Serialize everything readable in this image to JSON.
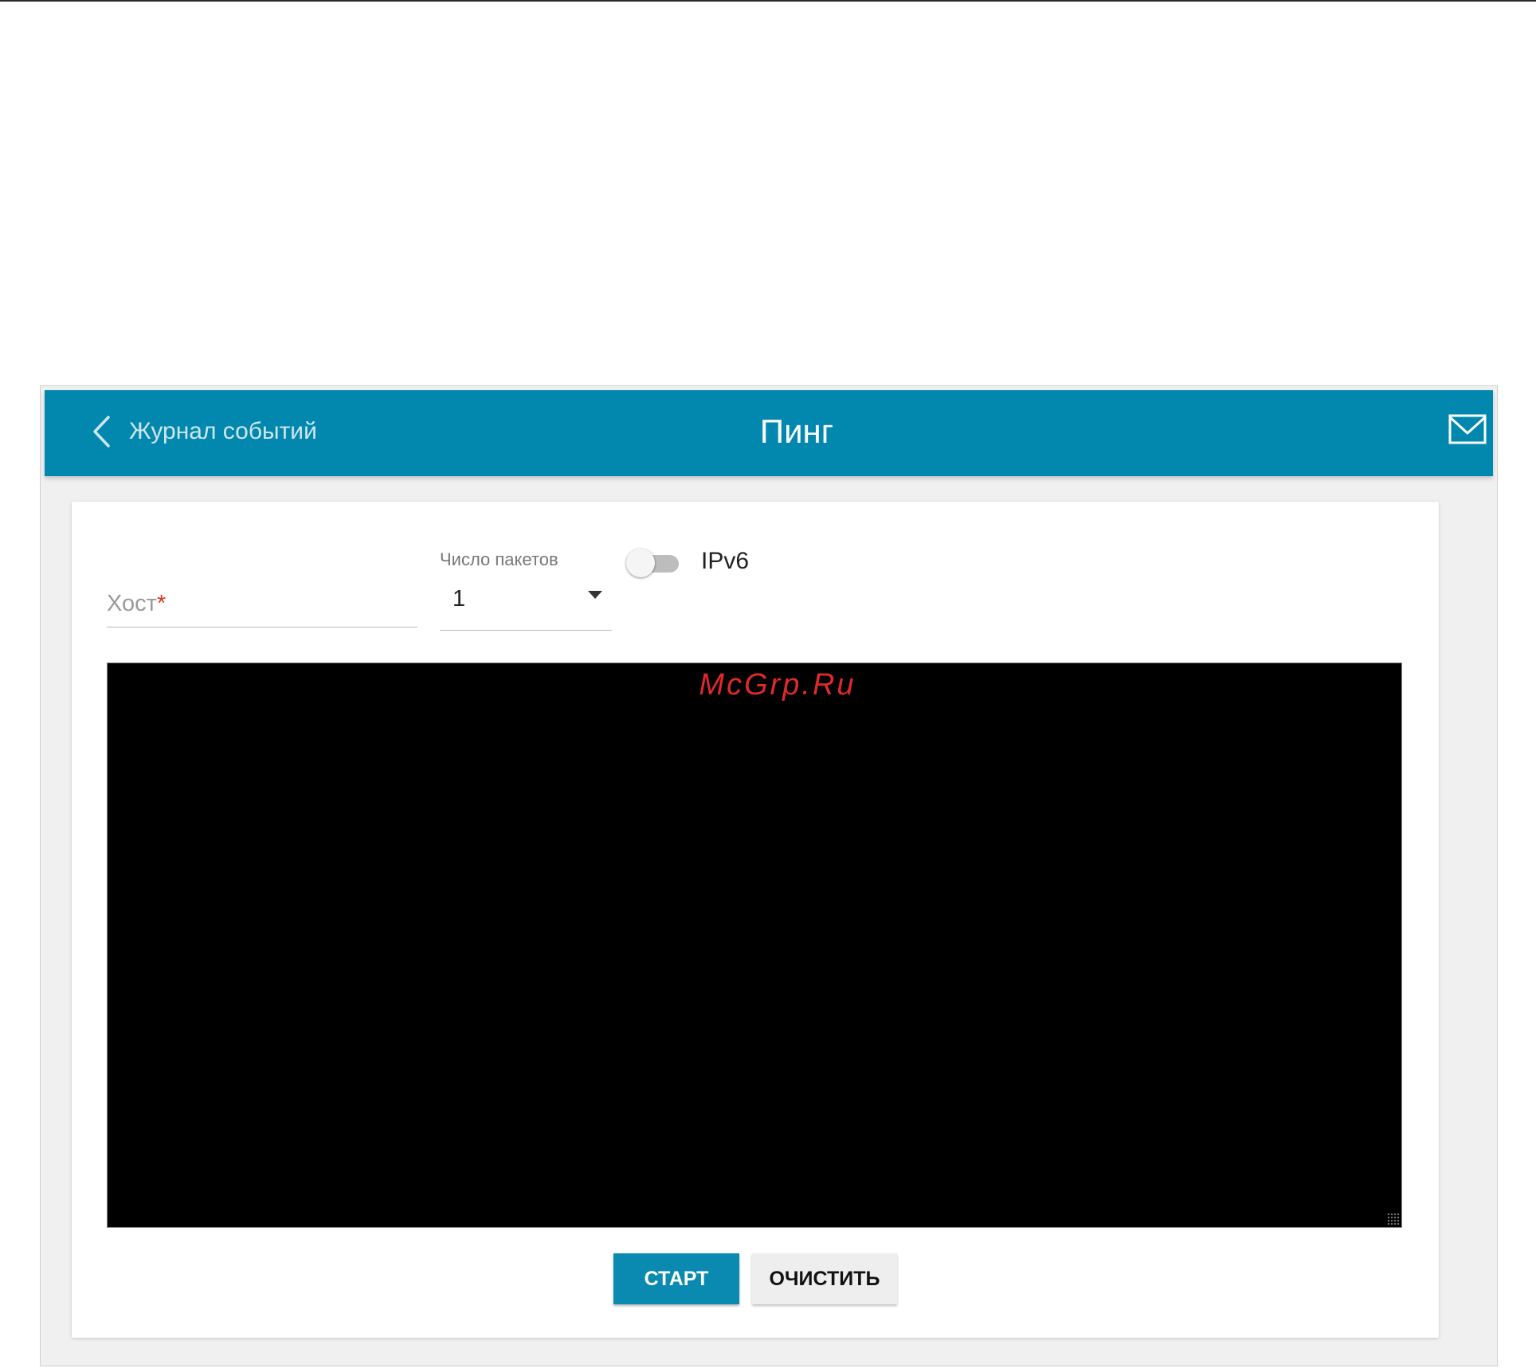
{
  "header": {
    "back_label": "Журнал событий",
    "title": "Пинг"
  },
  "form": {
    "host": {
      "label": "Хост",
      "required_mark": "*",
      "value": ""
    },
    "packets": {
      "label": "Число пакетов",
      "value": "1"
    },
    "ipv6": {
      "label": "IPv6",
      "enabled": false
    }
  },
  "console": {
    "watermark": "McGrp.Ru"
  },
  "actions": {
    "start_label": "СТАРТ",
    "clear_label": "ОЧИСТИТЬ"
  },
  "colors": {
    "header_bg": "#0288ae",
    "primary_button": "#0a8ab0",
    "required": "#d9341f",
    "watermark": "#e02a2a"
  },
  "icons": {
    "back": "chevron-left-icon",
    "mail": "mail-icon",
    "dropdown": "chevron-down-icon"
  }
}
